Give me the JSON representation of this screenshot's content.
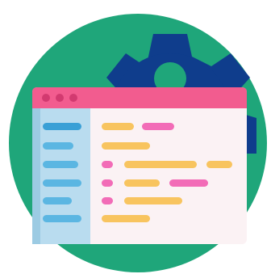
{
  "icon": {
    "name": "settings-code-window-icon",
    "colors": {
      "circle": "#1fa67a",
      "gear": "#0f3d8c",
      "window_titlebar": "#f25c8f",
      "window_body": "#fbf2f4",
      "window_dot": "#d23a70",
      "sidebar": "#b9dcef",
      "sidebar_shade": "#9ccbe3",
      "sidebar_line_active": "#3aa0d6",
      "sidebar_line": "#5bb6e2",
      "code_yellow": "#f8c45f",
      "code_pink": "#f26cb7"
    }
  }
}
